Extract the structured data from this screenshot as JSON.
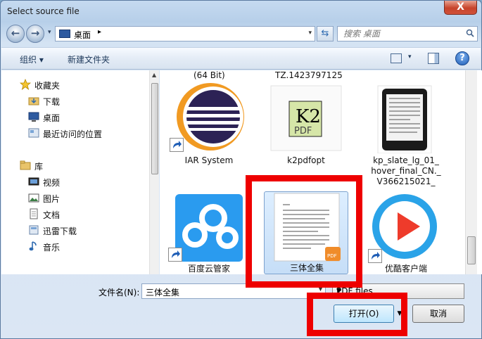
{
  "window": {
    "title": "Select source file",
    "close_label": "X"
  },
  "nav": {
    "back": "←",
    "forward": "→",
    "history": "▾",
    "address": "桌面",
    "address_sep": "▸",
    "address_dropdown": "▾",
    "refresh": "⇆",
    "search_placeholder": "搜索 桌面"
  },
  "toolbar": {
    "organize": "组织 ▾",
    "new_folder": "新建文件夹",
    "view_dropdown": "▾",
    "help": "?"
  },
  "sidebar": {
    "items": [
      {
        "label": "收藏夹",
        "icon": "star-icon"
      },
      {
        "label": "下载",
        "icon": "download-folder-icon"
      },
      {
        "label": "桌面",
        "icon": "desktop-icon"
      },
      {
        "label": "最近访问的位置",
        "icon": "recent-places-icon"
      },
      {
        "label": "库",
        "icon": "library-icon"
      },
      {
        "label": "视频",
        "icon": "video-icon"
      },
      {
        "label": "图片",
        "icon": "picture-icon"
      },
      {
        "label": "文档",
        "icon": "document-icon"
      },
      {
        "label": "迅雷下载",
        "icon": "thunder-download-icon"
      },
      {
        "label": "音乐",
        "icon": "music-icon"
      }
    ]
  },
  "files": {
    "cut_labels": [
      "(64 Bit)",
      "TZ.1423797125"
    ],
    "items": [
      {
        "name": "IAR System",
        "icon": "eclipse-icon"
      },
      {
        "name": "k2pdfopt",
        "icon": "k2pdf-icon",
        "icon_text_top": "K2",
        "icon_text_bottom": "PDF"
      },
      {
        "name": "kp_slate_lg_01_ hover_final_CN._ V366215021_",
        "icon": "ereader-image-icon"
      },
      {
        "name": "百度云管家",
        "icon": "baidu-cloud-icon"
      },
      {
        "name": "三体全集",
        "icon": "pdf-document-icon",
        "badge": "PDF"
      },
      {
        "name": "优酷客户端",
        "icon": "youku-icon"
      }
    ]
  },
  "footer": {
    "filename_label": "文件名(N):",
    "filename_value": "三体全集",
    "filetype_value": "PDF files",
    "open_label": "打开(O)",
    "cancel_label": "取消"
  }
}
